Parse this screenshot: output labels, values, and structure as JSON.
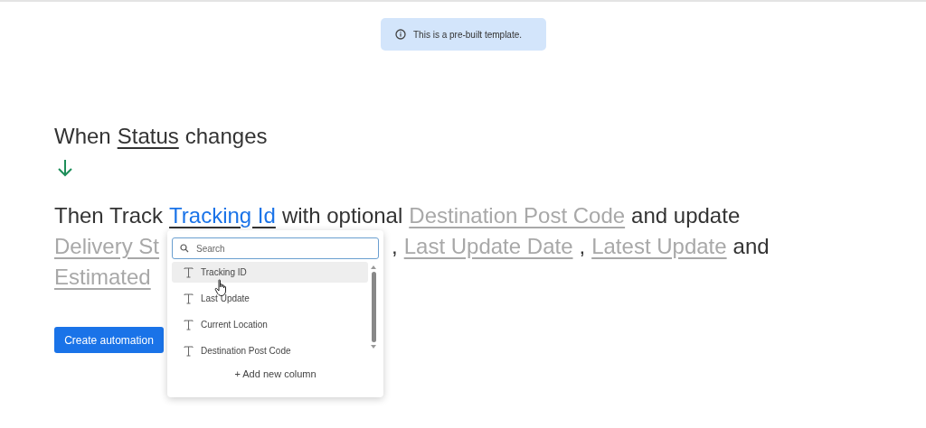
{
  "banner": {
    "text": "This is a pre-built template."
  },
  "sentence": {
    "lines": [
      [
        {
          "kind": "text",
          "text": "When"
        },
        {
          "kind": "trigger",
          "text": "Status"
        },
        {
          "kind": "text",
          "text": "changes"
        }
      ],
      [
        {
          "kind": "text",
          "text": "Then Track"
        },
        {
          "kind": "mapped",
          "text": "Tracking Id"
        },
        {
          "kind": "text",
          "text": "with optional"
        },
        {
          "kind": "optional",
          "text": "Destination Post Code"
        },
        {
          "kind": "text",
          "text": "and update"
        }
      ],
      [
        {
          "kind": "optional",
          "text": "Delivery St",
          "cut": true
        },
        {
          "kind": "text",
          "text": ","
        },
        {
          "kind": "optional",
          "text": "Last Update Date"
        },
        {
          "kind": "text",
          "text": ","
        },
        {
          "kind": "optional",
          "text": "Latest Update"
        },
        {
          "kind": "text",
          "text": "and"
        }
      ],
      [
        {
          "kind": "optional",
          "text": "Estimated",
          "cut": true
        }
      ]
    ]
  },
  "dropdown": {
    "search": {
      "placeholder": "Search"
    },
    "items": [
      {
        "label": "Tracking ID",
        "selected": true
      },
      {
        "label": "Last Update",
        "selected": false
      },
      {
        "label": "Current Location",
        "selected": false
      },
      {
        "label": "Destination Post Code",
        "selected": false
      }
    ],
    "add": "+ Add new column"
  },
  "button": "Create automation"
}
